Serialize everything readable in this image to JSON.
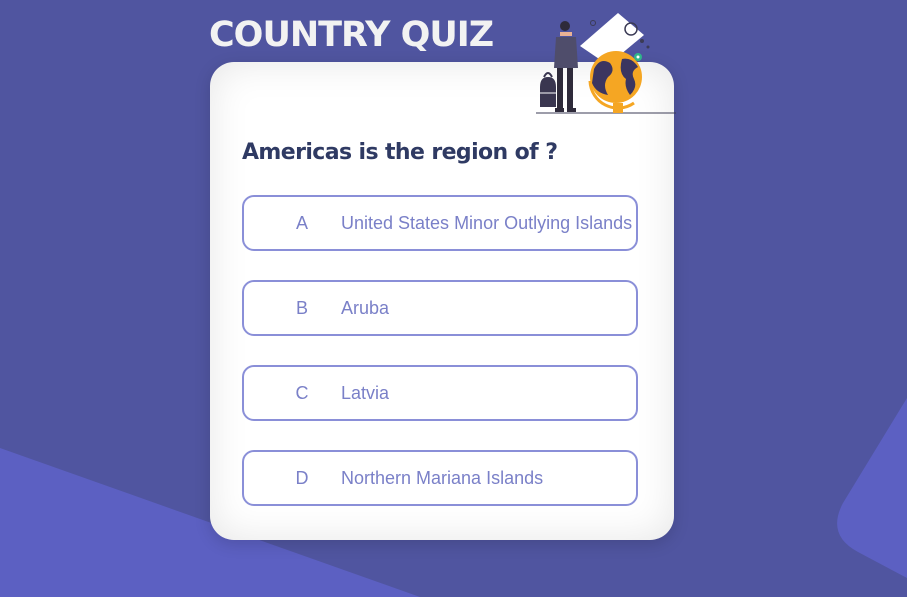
{
  "title": "COUNTRY QUIZ",
  "question": "Americas is the region of ?",
  "options": [
    {
      "letter": "A",
      "text": "United States Minor Outlying Islands"
    },
    {
      "letter": "B",
      "text": "Aruba"
    },
    {
      "letter": "C",
      "text": "Latvia"
    },
    {
      "letter": "D",
      "text": "Northern Mariana Islands"
    }
  ],
  "colors": {
    "background": "#5055a0",
    "background_accent": "#5c60c2",
    "card": "#ffffff",
    "option_border": "#8a8fd8",
    "option_text": "#7a80c8",
    "question_text": "#2f3a63",
    "globe": "#f5a623"
  },
  "icons": {
    "illustration": "traveler-with-globe-illustration"
  }
}
